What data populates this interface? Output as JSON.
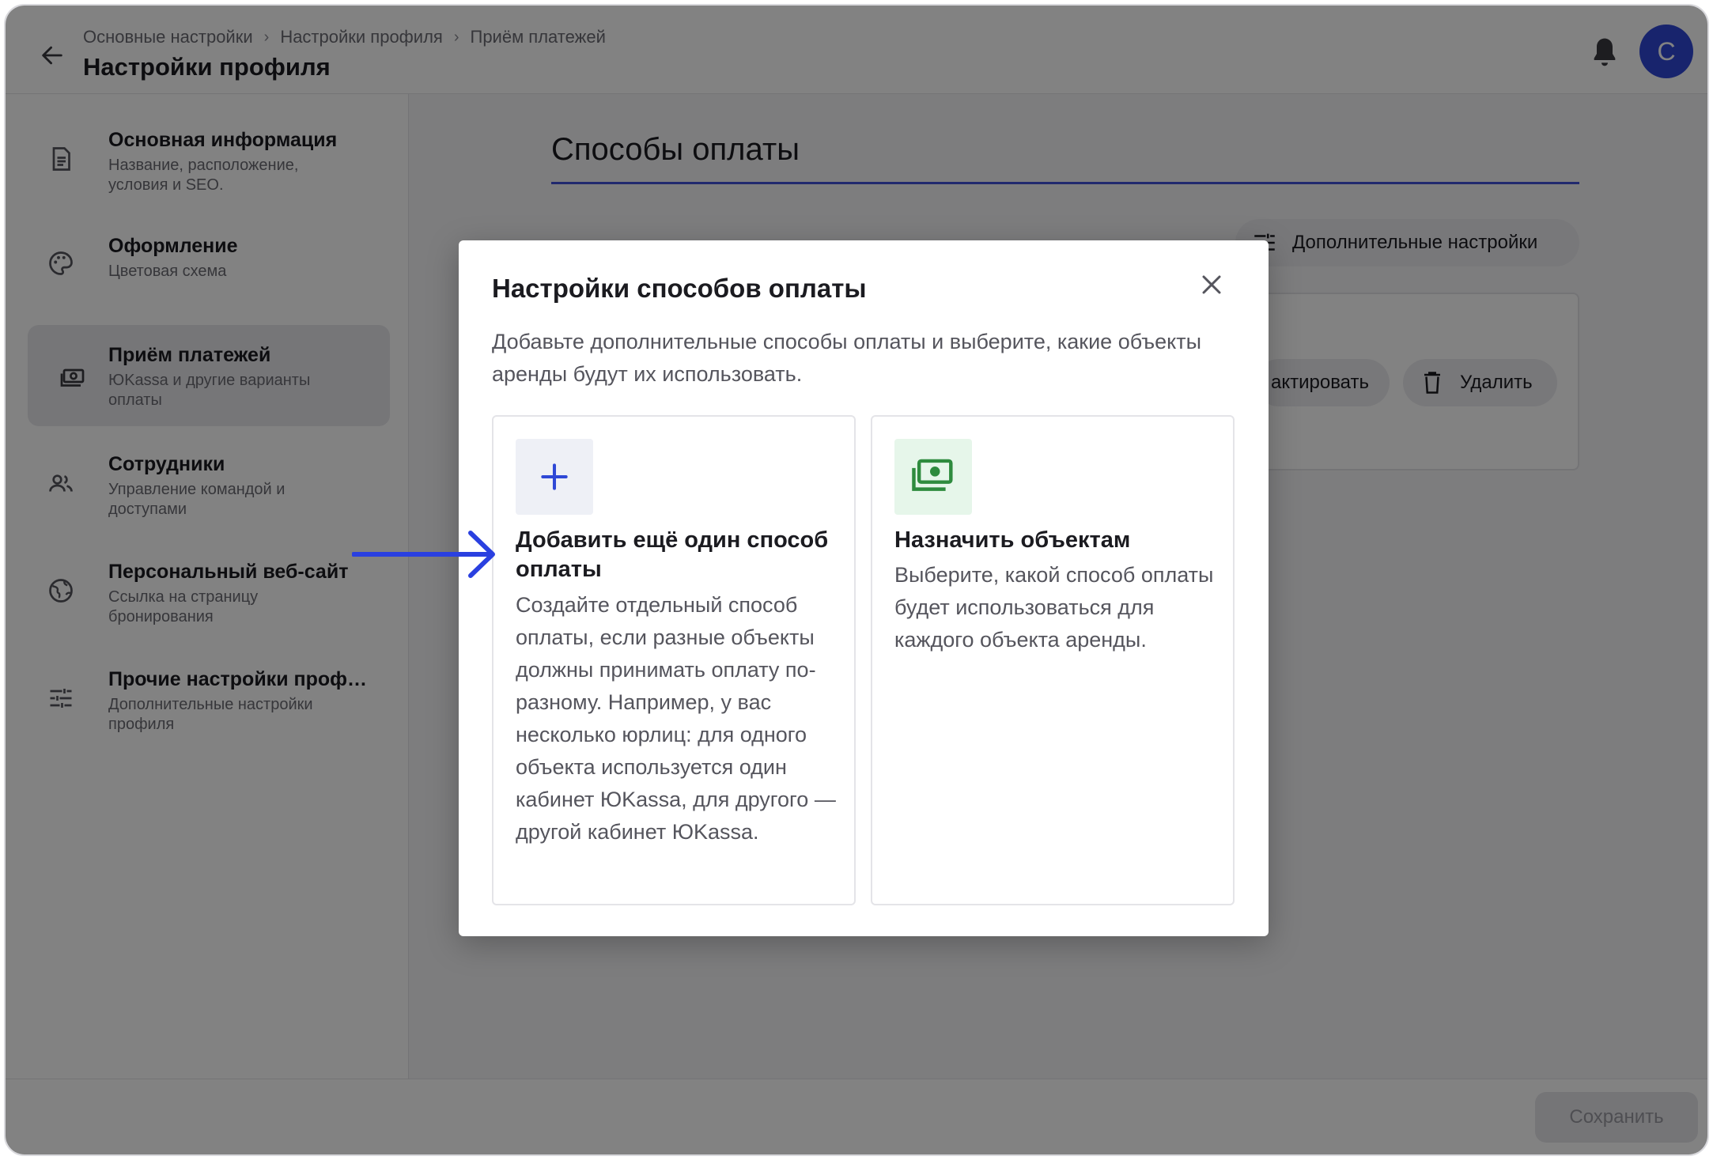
{
  "header": {
    "breadcrumbs": [
      "Основные настройки",
      "Настройки профиля",
      "Приём платежей"
    ],
    "title": "Настройки профиля",
    "avatar_letter": "C"
  },
  "sidebar": {
    "items": [
      {
        "title": "Основная информация",
        "subtitle": "Название, расположение, условия и SEO.",
        "icon": "document-icon",
        "active": false
      },
      {
        "title": "Оформление",
        "subtitle": "Цветовая схема",
        "icon": "palette-icon",
        "active": false
      },
      {
        "title": "Приём платежей",
        "subtitle": "ЮKassa и другие варианты оплаты",
        "icon": "payments-icon",
        "active": true
      },
      {
        "title": "Сотрудники",
        "subtitle": "Управление командой и доступами",
        "icon": "people-icon",
        "active": false
      },
      {
        "title": "Персональный веб-сайт",
        "subtitle": "Ссылка на страницу бронирования",
        "icon": "globe-icon",
        "active": false
      },
      {
        "title": "Прочие настройки проф…",
        "subtitle": "Дополнительные настройки профиля",
        "icon": "sliders-icon",
        "active": false
      }
    ]
  },
  "main": {
    "section_title": "Способы оплаты",
    "extra_settings_label": "Дополнительные настройки",
    "edit_label_partial": "актировать",
    "delete_label": "Удалить"
  },
  "footer": {
    "save_label": "Сохранить"
  },
  "modal": {
    "title": "Настройки способов оплаты",
    "description": "Добавьте дополнительные способы оплаты и выберите, какие объекты аренды будут их использовать.",
    "options": [
      {
        "title": "Добавить ещё один способ оплаты",
        "description": "Создайте отдельный способ оплаты, если разные объекты должны принимать оплату по-разному. Например, у вас несколько юрлиц: для одного объекта используется один кабинет ЮKassa, для другого — другой кабинет ЮKassa.",
        "icon": "plus-icon"
      },
      {
        "title": "Назначить объектам",
        "description": "Выберите, какой способ оплаты будет использоваться для каждого объекта аренды.",
        "icon": "payments-icon"
      }
    ]
  },
  "colors": {
    "accent": "#2f48d6",
    "overlay": "#000000",
    "assign_icon_bg": "#e6f6ea",
    "assign_icon_fg": "#2e8b3e",
    "add_icon_bg": "#eef0f6",
    "annotation_arrow": "#2a40e0"
  }
}
